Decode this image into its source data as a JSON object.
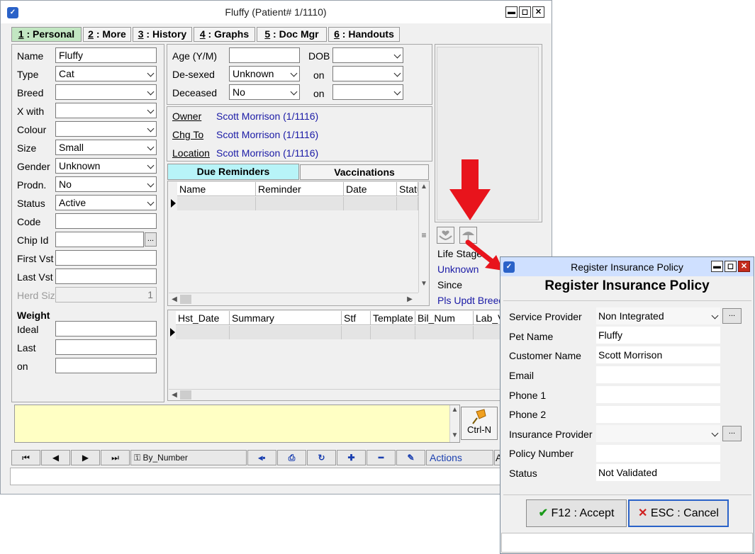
{
  "window": {
    "title": "Fluffy (Patient# 1/1110)",
    "min": "▬",
    "max": "◻",
    "close": "✕"
  },
  "tabs": [
    {
      "key": "1",
      "label": " : Personal"
    },
    {
      "key": "2",
      "label": " : More"
    },
    {
      "key": "3",
      "label": " : History"
    },
    {
      "key": "4",
      "label": " : Graphs"
    },
    {
      "key": "5",
      "label": " : Doc Mgr"
    },
    {
      "key": "6",
      "label": " : Handouts"
    }
  ],
  "personal": {
    "name_label": "Name",
    "name": "Fluffy",
    "type_label": "Type",
    "type": "Cat",
    "breed_label": "Breed",
    "breed": "",
    "xwith_label": "X with",
    "xwith": "",
    "colour_label": "Colour",
    "colour": "",
    "size_label": "Size",
    "size": "Small",
    "gender_label": "Gender",
    "gender": "Unknown",
    "prodn_label": "Prodn.",
    "prodn": "No",
    "status_label": "Status",
    "status": "Active",
    "code_label": "Code",
    "code": "",
    "chip_label": "Chip Id",
    "chip": "",
    "chip_btn": "...",
    "firstvst_label": "First Vst",
    "firstvst": "",
    "lastvst_label": "Last Vst",
    "lastvst": "",
    "herd_label": "Herd Siz",
    "herd": "1"
  },
  "weight": {
    "heading": "Weight",
    "ideal_label": "Ideal",
    "last_label": "Last",
    "on_label": "on"
  },
  "details": {
    "age_label": "Age (Y/M)",
    "age": "",
    "dob_label": "DOB",
    "dob": "",
    "desexed_label": "De-sexed",
    "desexed": "Unknown",
    "on1_label": "on",
    "on1": "",
    "deceased_label": "Deceased",
    "deceased": "No",
    "on2_label": "on",
    "on2": ""
  },
  "links": {
    "owner_label": "Owner",
    "owner": "Scott Morrison (1/1116)",
    "chgto_label": "Chg To",
    "chgto": "Scott Morrison (1/1116)",
    "location_label": "Location",
    "location": "Scott Morrison (1/1116)"
  },
  "reminders": {
    "tab_due": "Due Reminders",
    "tab_due_key": "D",
    "tab_vacc": "Vaccinations",
    "tab_vacc_key": "V",
    "columns": [
      "Name",
      "Reminder",
      "Date",
      "Statu"
    ]
  },
  "history_grid": {
    "columns": [
      "Hst_Date",
      "Summary",
      "Stf",
      "Template",
      "Bil_Num",
      "Lab_V"
    ]
  },
  "side": {
    "lifestage_label": "Life Stage",
    "lifestage": "Unknown",
    "since_label": "Since",
    "breed_note": "Pls Updt Breed"
  },
  "notes": {
    "pin_label": "Ctrl-N"
  },
  "navbar": {
    "sort": "By_Number",
    "actions": "Actions",
    "more": "A"
  },
  "colors": {
    "accent_green": "#c2e6c2",
    "reminder_tab": "#b8f4f8",
    "notes_bg": "#ffffc4",
    "arrow_red": "#e8141c",
    "link_blue": "#1a1aa6"
  },
  "dialog": {
    "title": "Register Insurance Policy",
    "heading": "Register Insurance Policy",
    "service_provider_label": "Service Provider",
    "service_provider": "Non Integrated",
    "pet_name_label": "Pet Name",
    "pet_name": "Fluffy",
    "customer_name_label": "Customer Name",
    "customer_name": "Scott Morrison",
    "email_label": "Email",
    "email": "",
    "phone1_label": "Phone 1",
    "phone1": "",
    "phone2_label": "Phone 2",
    "phone2": "",
    "insurance_provider_label": "Insurance Provider",
    "insurance_provider": "",
    "policy_number_label": "Policy Number",
    "policy_number": "",
    "status_label": "Status",
    "status": "Not Validated",
    "browse": "...",
    "accept": "F12 : Accept",
    "cancel": "ESC : Cancel"
  }
}
